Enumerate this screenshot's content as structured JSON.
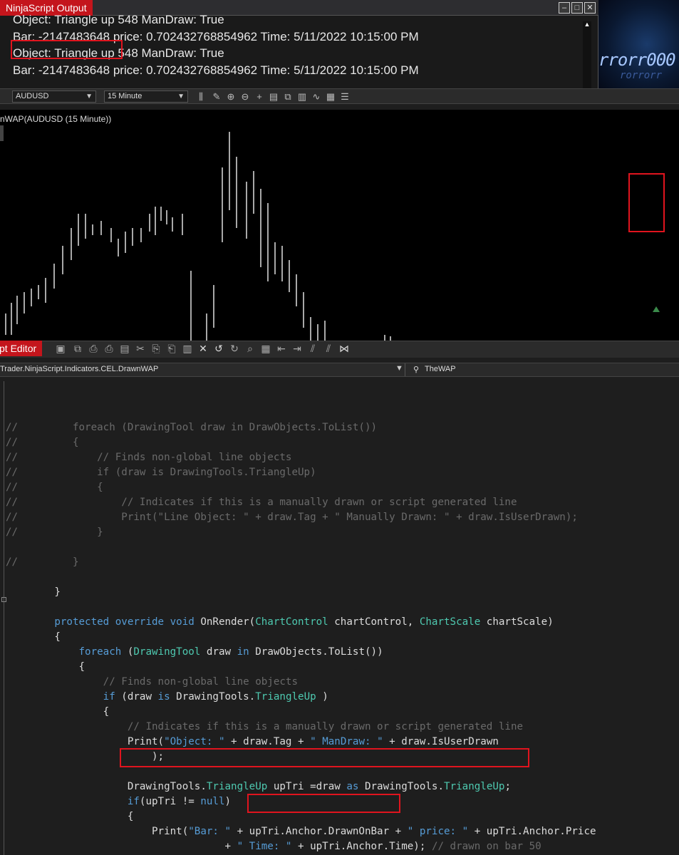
{
  "output_window": {
    "title": "NinjaScript Output",
    "lines": [
      "Object: Triangle up 548 ManDraw: True",
      "Bar: -2147483648 price: 0.702432768854962 Time: 5/11/2022 10:15:00 PM",
      "Object: Triangle up 548 ManDraw: True",
      "Bar: -2147483648 price: 0.702432768854962 Time: 5/11/2022 10:15:00 PM"
    ],
    "bg_text": "rrorr000",
    "bg_text2": "rorrorr"
  },
  "chart_toolbar": {
    "instrument": "AUDUSD",
    "interval": "15 Minute"
  },
  "chart": {
    "title": "nWAP(AUDUSD (15 Minute))"
  },
  "editor": {
    "title": "pt Editor",
    "path": "Trader.NinjaScript.Indicators.CEL.DrawnWAP",
    "member": "TheWAP"
  },
  "code_lines": [
    {
      "y": 0,
      "t": ""
    },
    {
      "y": 1,
      "parts": [
        [
          "cm",
          "//         foreach (DrawingTool draw in DrawObjects.ToList())"
        ]
      ]
    },
    {
      "y": 2,
      "parts": [
        [
          "cm",
          "//         {"
        ]
      ]
    },
    {
      "y": 3,
      "parts": [
        [
          "cm",
          "//             // Finds non-global line objects"
        ]
      ]
    },
    {
      "y": 4,
      "parts": [
        [
          "cm",
          "//             if (draw is DrawingTools.TriangleUp)"
        ]
      ]
    },
    {
      "y": 5,
      "parts": [
        [
          "cm",
          "//             {"
        ]
      ]
    },
    {
      "y": 6,
      "parts": [
        [
          "cm",
          "//                 // Indicates if this is a manually drawn or script generated line"
        ]
      ]
    },
    {
      "y": 7,
      "parts": [
        [
          "cm",
          "//                 Print(\"Line Object: \" + draw.Tag + \" Manually Drawn: \" + draw.IsUserDrawn);"
        ]
      ]
    },
    {
      "y": 8,
      "parts": [
        [
          "cm",
          "//             }"
        ]
      ]
    },
    {
      "y": 10,
      "parts": [
        [
          "cm",
          "//         }"
        ]
      ]
    },
    {
      "y": 12,
      "parts": [
        [
          "n",
          "        }"
        ]
      ]
    },
    {
      "y": 14,
      "parts": [
        [
          "k",
          "        protected override void "
        ],
        [
          "n",
          "OnRender("
        ],
        [
          "t",
          "ChartControl"
        ],
        [
          "n",
          " chartControl, "
        ],
        [
          "t",
          "ChartScale"
        ],
        [
          "n",
          " chartScale)"
        ]
      ]
    },
    {
      "y": 15,
      "parts": [
        [
          "n",
          "        {"
        ]
      ]
    },
    {
      "y": 16,
      "parts": [
        [
          "k",
          "            foreach"
        ],
        [
          "n",
          " ("
        ],
        [
          "t",
          "DrawingTool"
        ],
        [
          "n",
          " draw "
        ],
        [
          "k",
          "in"
        ],
        [
          "n",
          " DrawObjects.ToList())"
        ]
      ]
    },
    {
      "y": 17,
      "parts": [
        [
          "n",
          "            {"
        ]
      ]
    },
    {
      "y": 18,
      "parts": [
        [
          "cm",
          "                // Finds non-global line objects"
        ]
      ]
    },
    {
      "y": 19,
      "parts": [
        [
          "k",
          "                if"
        ],
        [
          "n",
          " (draw "
        ],
        [
          "k",
          "is"
        ],
        [
          "n",
          " DrawingTools."
        ],
        [
          "t",
          "TriangleUp"
        ],
        [
          "n",
          " )"
        ]
      ]
    },
    {
      "y": 20,
      "parts": [
        [
          "n",
          "                {"
        ]
      ]
    },
    {
      "y": 21,
      "parts": [
        [
          "cm",
          "                    // Indicates if this is a manually drawn or script generated line"
        ]
      ]
    },
    {
      "y": 22,
      "parts": [
        [
          "n",
          "                    Print("
        ],
        [
          "s",
          "\"Object: \""
        ],
        [
          "n",
          " + draw.Tag + "
        ],
        [
          "s",
          "\" ManDraw: \""
        ],
        [
          "n",
          " + draw.IsUserDrawn"
        ]
      ]
    },
    {
      "y": 23,
      "parts": [
        [
          "n",
          "                        );"
        ]
      ]
    },
    {
      "y": 25,
      "parts": [
        [
          "n",
          "                    DrawingTools."
        ],
        [
          "t",
          "TriangleUp"
        ],
        [
          "n",
          " upTri =draw "
        ],
        [
          "k",
          "as"
        ],
        [
          "n",
          " DrawingTools."
        ],
        [
          "t",
          "TriangleUp"
        ],
        [
          "n",
          ";"
        ]
      ]
    },
    {
      "y": 26,
      "parts": [
        [
          "k",
          "                    if"
        ],
        [
          "n",
          "(upTri != "
        ],
        [
          "k",
          "null"
        ],
        [
          "n",
          ")"
        ]
      ]
    },
    {
      "y": 27,
      "parts": [
        [
          "n",
          "                    {"
        ]
      ]
    },
    {
      "y": 28,
      "parts": [
        [
          "n",
          "                        Print("
        ],
        [
          "s",
          "\"Bar: \""
        ],
        [
          "n",
          " + upTri.Anchor.DrawnOnBar + "
        ],
        [
          "s",
          "\" price: \""
        ],
        [
          "n",
          " + upTri.Anchor.Price"
        ]
      ]
    },
    {
      "y": 29,
      "parts": [
        [
          "n",
          "                                    + "
        ],
        [
          "s",
          "\" Time: \""
        ],
        [
          "n",
          " + upTri.Anchor.Time); "
        ],
        [
          "cm",
          "// drawn on bar 50"
        ]
      ]
    },
    {
      "y": 30,
      "parts": [
        [
          "n",
          "                    }"
        ]
      ]
    }
  ],
  "colors": {
    "accent_red": "#c4151c",
    "highlight": "#e0141e",
    "triangle": "#3a8a4a"
  }
}
